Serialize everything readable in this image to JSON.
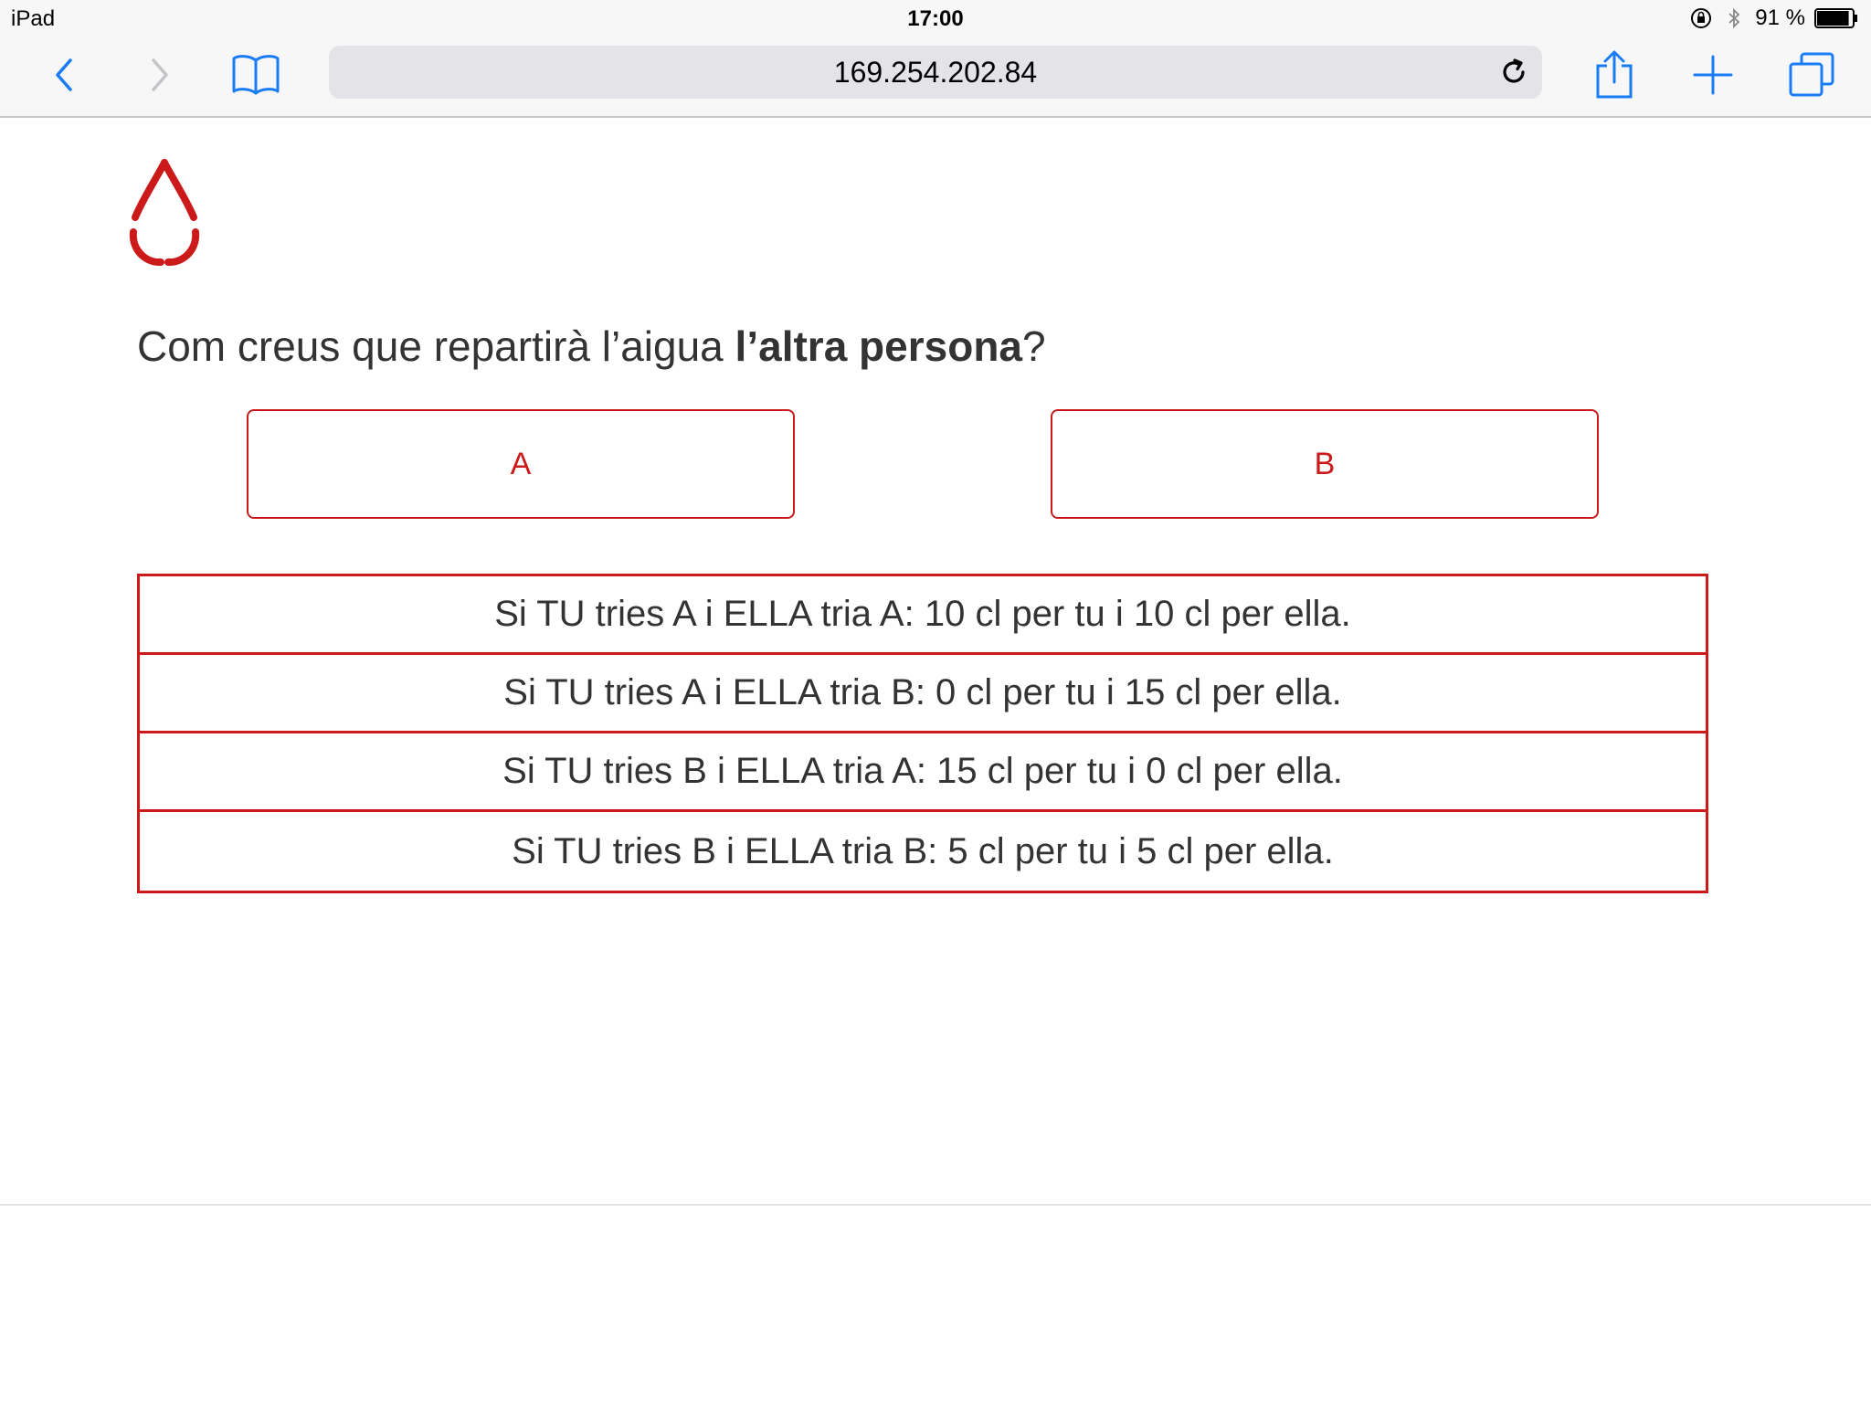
{
  "status_bar": {
    "device": "iPad",
    "time": "17:00",
    "battery": "91 %",
    "battery_level": 0.91
  },
  "browser": {
    "url": "169.254.202.84",
    "accent_color": "#1a7cf5"
  },
  "page": {
    "question_plain": "Com creus que repartirà l’aigua ",
    "question_bold": "l’altra persona",
    "question_end": "?",
    "choices": [
      {
        "label": "A"
      },
      {
        "label": "B"
      }
    ],
    "payoffs": [
      "Si TU tries A i ELLA tria A: 10 cl per tu i 10 cl per ella.",
      "Si TU tries A i ELLA tria B: 0 cl per tu i 15 cl per ella.",
      "Si TU tries B i ELLA tria A: 15 cl per tu i 0 cl per ella.",
      "Si TU tries B i ELLA tria B: 5 cl per tu i 5 cl per ella."
    ],
    "brand_color": "#cc1a1a"
  }
}
